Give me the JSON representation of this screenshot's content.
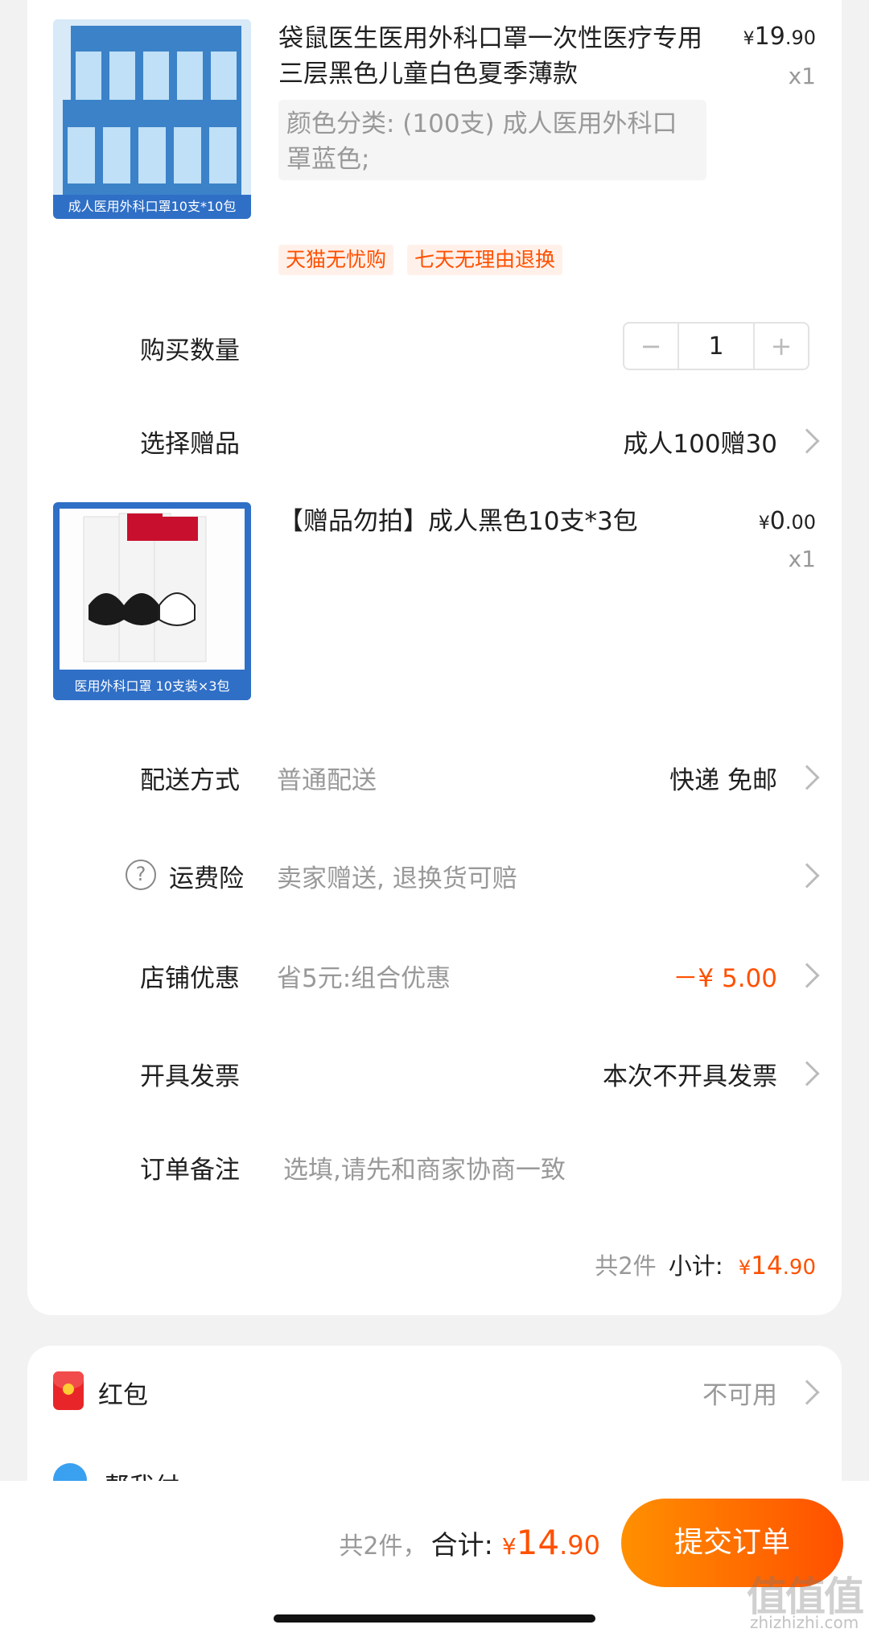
{
  "item1": {
    "title": "袋鼠医生医用外科口罩一次性医疗专用三层黑色儿童白色夏季薄款",
    "price_yen": "¥",
    "price_int": "19",
    "price_dec": ".90",
    "qty": "x1",
    "sku": "颜色分类: (100支) 成人医用外科口罩蓝色;",
    "image_caption": "成人医用外科口罩10支*10包",
    "tags": [
      "天猫无忧购",
      "七天无理由退换"
    ]
  },
  "quantity": {
    "label": "购买数量",
    "value": "1",
    "minus": "−",
    "plus": "+"
  },
  "gift": {
    "label": "选择赠品",
    "value": "成人100赠30"
  },
  "item2": {
    "title": "【赠品勿拍】成人黑色10支*3包",
    "price_yen": "¥",
    "price_int": "0",
    "price_dec": ".00",
    "qty": "x1",
    "image_caption": "医用外科口罩   10支装×3包"
  },
  "shipping": {
    "label": "配送方式",
    "sub": "普通配送",
    "value": "快递 免邮"
  },
  "insurance": {
    "icon": "?",
    "label": "运费险",
    "sub": "卖家赠送, 退换货可赔"
  },
  "discount": {
    "label": "店铺优惠",
    "sub": "省5元:组合优惠",
    "value": "－¥ 5.00"
  },
  "invoice": {
    "label": "开具发票",
    "value": "本次不开具发票"
  },
  "note": {
    "label": "订单备注",
    "placeholder": "选填,请先和商家协商一致"
  },
  "subtotal": {
    "count": "共2件",
    "label": "小计:",
    "yen": "¥",
    "int": "14",
    "dec": ".90"
  },
  "redpacket": {
    "label": "红包",
    "value": "不可用"
  },
  "helppay": {
    "label": "帮我付"
  },
  "footer": {
    "count": "共2件，",
    "label": "合计:",
    "yen": "¥",
    "int": "14",
    "dec": ".90",
    "submit": "提交订单"
  },
  "watermark": {
    "logo": "值值值",
    "url": "zhizhizhi.com"
  },
  "colors": {
    "accent": "#ff5000",
    "submit_gradient_start": "#ff9000",
    "submit_gradient_end": "#ff5000"
  }
}
